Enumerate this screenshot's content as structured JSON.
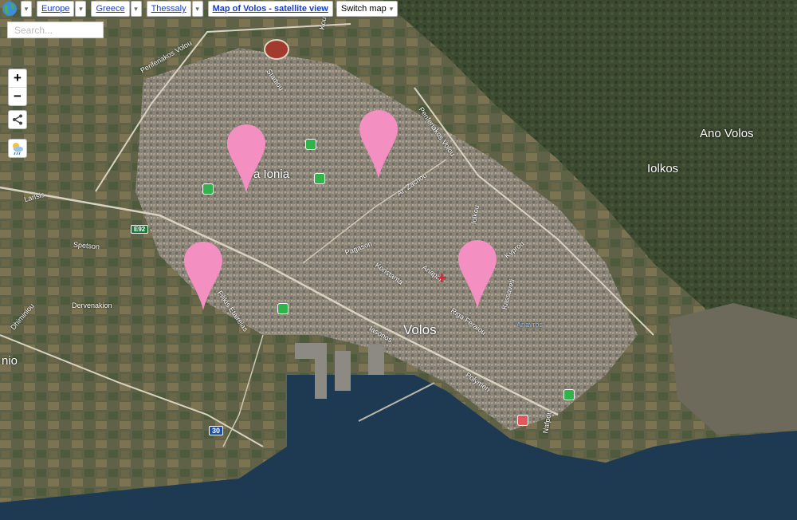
{
  "toolbar": {
    "crumbs": [
      "Europe",
      "Greece",
      "Thessaly"
    ],
    "title": "Map of Volos - satellite view",
    "switch": "Switch map"
  },
  "search": {
    "placeholder": "Search..."
  },
  "controls": {
    "zoom_in": "+",
    "zoom_out": "−"
  },
  "map": {
    "place_labels": {
      "volos": "Volos",
      "nea_ionia": "a Ionia",
      "ano_volos": "Ano Volos",
      "iolkos": "Iolkos",
      "nio": "nio"
    },
    "street_labels": {
      "periferiakos_volou_1": "Periferiakos Volou",
      "periferiakos_volou_2": "Periferiakos Volou",
      "stadiou": "Stadiou",
      "larisis": "Larisis",
      "spetson": "Spetson",
      "dervenakion": "Dervenakion",
      "dhiminiou": "Dhiminiou",
      "filikis_etaireias": "Filikis Etaireias",
      "pagason": "Pagason",
      "konstanta": "Konstanta",
      "anapafseos": "Anapaf.",
      "riga_feraiou": "Riga Feraiou",
      "iasonos": "Iasonos",
      "ar_zachou": "Ar. Zachou",
      "iolkou": "Iolkou",
      "kyprou": "Kyprou",
      "kassavetí": "Kassaveti",
      "polymeri": "Polymeri",
      "nafpou": "Nafpou",
      "koutou": "Koutou",
      "anavros": "Anavros"
    },
    "shields": {
      "e92": "E92",
      "r30": "30"
    },
    "pin_color": "#f48fc1",
    "water_color": "#1e3a52"
  }
}
